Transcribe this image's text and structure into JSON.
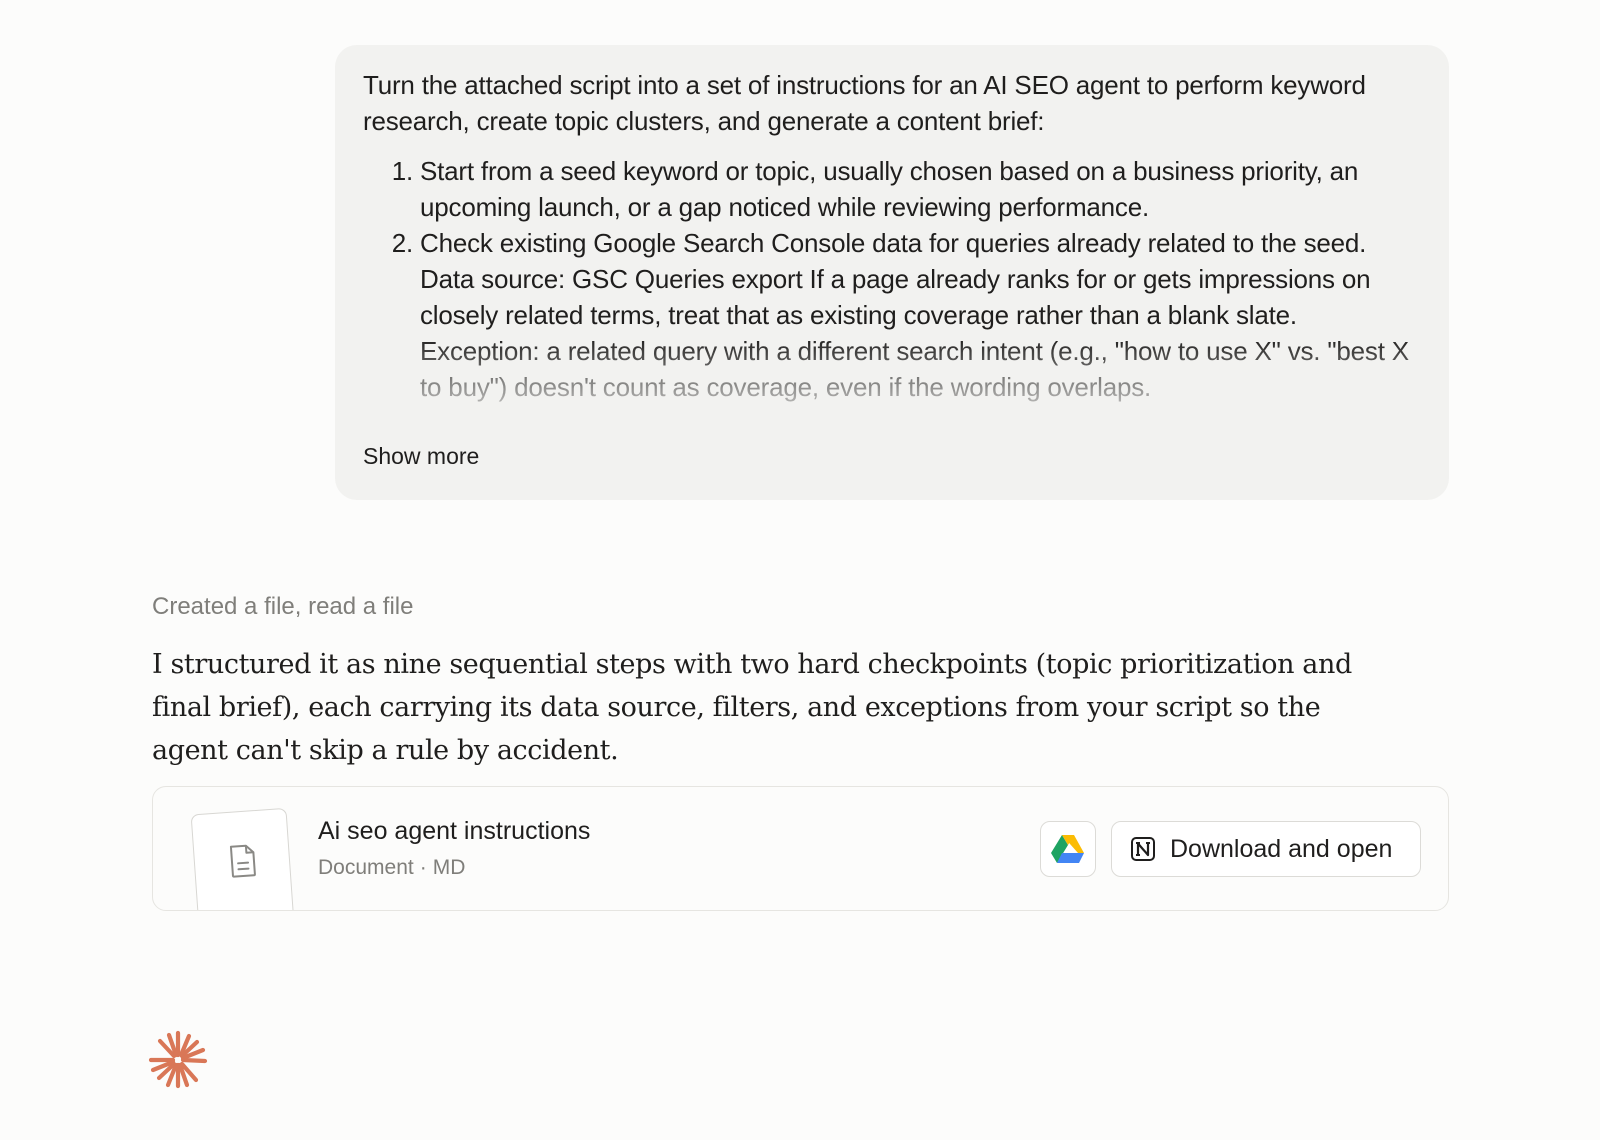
{
  "user_message": {
    "intro": "Turn the attached script into a set of instructions for an AI SEO agent to perform keyword research, create topic clusters, and generate a content brief:",
    "steps": [
      "Start from a seed keyword or topic, usually chosen based on a business priority, an upcoming launch, or a gap noticed while reviewing performance.",
      "Check existing Google Search Console data for queries already related to the seed. Data source: GSC Queries export If a page already ranks for or gets impressions on closely related terms, treat that as existing coverage rather than a blank slate. Exception: a related query with a different search intent (e.g., \"how to use X\" vs. \"best X to buy\") doesn't count as coverage, even if the wording overlaps."
    ],
    "show_more_label": "Show more"
  },
  "assistant": {
    "tool_summary": "Created a file, read a file",
    "message": "I structured it as nine sequential steps with two hard checkpoints (topic prioritization and final brief), each carrying its data source, filters, and exceptions from your script so the agent can't skip a rule by accident.",
    "file": {
      "title": "Ai seo agent instructions",
      "type": "Document",
      "separator": "·",
      "format": "MD",
      "icon": "document-icon"
    },
    "actions": {
      "gdrive_icon": "google-drive-icon",
      "download_label": "Download and open",
      "download_icon": "notion-icon"
    }
  },
  "colors": {
    "accent": "#d97757",
    "bubble_bg": "#f2f2f0",
    "muted_text": "#7f7e7a"
  }
}
